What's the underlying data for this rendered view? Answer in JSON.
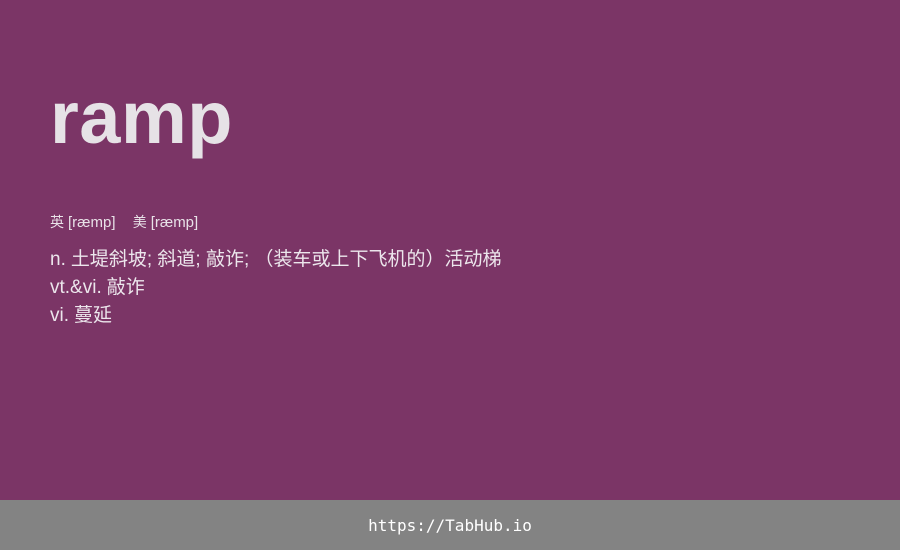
{
  "card": {
    "word": "ramp",
    "phonetics": [
      {
        "tag": "英",
        "ipa": "[ræmp]"
      },
      {
        "tag": "美",
        "ipa": "[ræmp]"
      }
    ],
    "definitions": [
      {
        "pos": "n.",
        "text": "土堤斜坡; 斜道; 敲诈; （装车或上下飞机的）活动梯"
      },
      {
        "pos": "vt.&vi.",
        "text": "敲诈"
      },
      {
        "pos": "vi.",
        "text": "蔓延"
      }
    ],
    "background_color": "#7b3566"
  },
  "footer": {
    "link_text": "https://TabHub.io",
    "background_color": "#838383"
  }
}
